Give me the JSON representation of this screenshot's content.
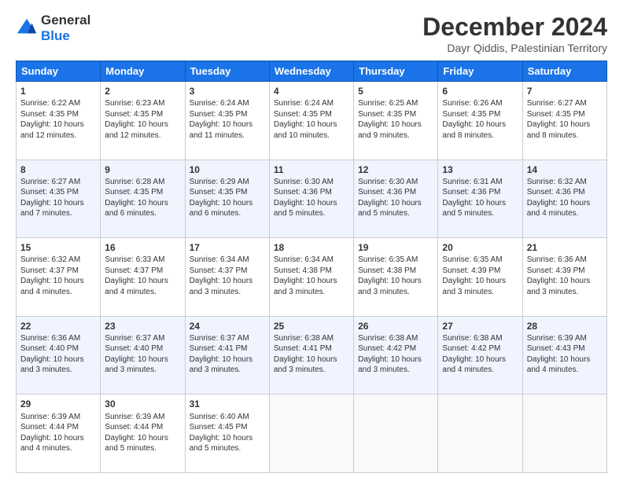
{
  "logo": {
    "line1": "General",
    "line2": "Blue"
  },
  "title": "December 2024",
  "subtitle": "Dayr Qiddis, Palestinian Territory",
  "days_header": [
    "Sunday",
    "Monday",
    "Tuesday",
    "Wednesday",
    "Thursday",
    "Friday",
    "Saturday"
  ],
  "weeks": [
    {
      "row_class": "row-normal",
      "days": [
        {
          "num": "1",
          "sunrise": "Sunrise: 6:22 AM",
          "sunset": "Sunset: 4:35 PM",
          "daylight": "Daylight: 10 hours and 12 minutes."
        },
        {
          "num": "2",
          "sunrise": "Sunrise: 6:23 AM",
          "sunset": "Sunset: 4:35 PM",
          "daylight": "Daylight: 10 hours and 12 minutes."
        },
        {
          "num": "3",
          "sunrise": "Sunrise: 6:24 AM",
          "sunset": "Sunset: 4:35 PM",
          "daylight": "Daylight: 10 hours and 11 minutes."
        },
        {
          "num": "4",
          "sunrise": "Sunrise: 6:24 AM",
          "sunset": "Sunset: 4:35 PM",
          "daylight": "Daylight: 10 hours and 10 minutes."
        },
        {
          "num": "5",
          "sunrise": "Sunrise: 6:25 AM",
          "sunset": "Sunset: 4:35 PM",
          "daylight": "Daylight: 10 hours and 9 minutes."
        },
        {
          "num": "6",
          "sunrise": "Sunrise: 6:26 AM",
          "sunset": "Sunset: 4:35 PM",
          "daylight": "Daylight: 10 hours and 8 minutes."
        },
        {
          "num": "7",
          "sunrise": "Sunrise: 6:27 AM",
          "sunset": "Sunset: 4:35 PM",
          "daylight": "Daylight: 10 hours and 8 minutes."
        }
      ]
    },
    {
      "row_class": "row-alt",
      "days": [
        {
          "num": "8",
          "sunrise": "Sunrise: 6:27 AM",
          "sunset": "Sunset: 4:35 PM",
          "daylight": "Daylight: 10 hours and 7 minutes."
        },
        {
          "num": "9",
          "sunrise": "Sunrise: 6:28 AM",
          "sunset": "Sunset: 4:35 PM",
          "daylight": "Daylight: 10 hours and 6 minutes."
        },
        {
          "num": "10",
          "sunrise": "Sunrise: 6:29 AM",
          "sunset": "Sunset: 4:35 PM",
          "daylight": "Daylight: 10 hours and 6 minutes."
        },
        {
          "num": "11",
          "sunrise": "Sunrise: 6:30 AM",
          "sunset": "Sunset: 4:36 PM",
          "daylight": "Daylight: 10 hours and 5 minutes."
        },
        {
          "num": "12",
          "sunrise": "Sunrise: 6:30 AM",
          "sunset": "Sunset: 4:36 PM",
          "daylight": "Daylight: 10 hours and 5 minutes."
        },
        {
          "num": "13",
          "sunrise": "Sunrise: 6:31 AM",
          "sunset": "Sunset: 4:36 PM",
          "daylight": "Daylight: 10 hours and 5 minutes."
        },
        {
          "num": "14",
          "sunrise": "Sunrise: 6:32 AM",
          "sunset": "Sunset: 4:36 PM",
          "daylight": "Daylight: 10 hours and 4 minutes."
        }
      ]
    },
    {
      "row_class": "row-normal",
      "days": [
        {
          "num": "15",
          "sunrise": "Sunrise: 6:32 AM",
          "sunset": "Sunset: 4:37 PM",
          "daylight": "Daylight: 10 hours and 4 minutes."
        },
        {
          "num": "16",
          "sunrise": "Sunrise: 6:33 AM",
          "sunset": "Sunset: 4:37 PM",
          "daylight": "Daylight: 10 hours and 4 minutes."
        },
        {
          "num": "17",
          "sunrise": "Sunrise: 6:34 AM",
          "sunset": "Sunset: 4:37 PM",
          "daylight": "Daylight: 10 hours and 3 minutes."
        },
        {
          "num": "18",
          "sunrise": "Sunrise: 6:34 AM",
          "sunset": "Sunset: 4:38 PM",
          "daylight": "Daylight: 10 hours and 3 minutes."
        },
        {
          "num": "19",
          "sunrise": "Sunrise: 6:35 AM",
          "sunset": "Sunset: 4:38 PM",
          "daylight": "Daylight: 10 hours and 3 minutes."
        },
        {
          "num": "20",
          "sunrise": "Sunrise: 6:35 AM",
          "sunset": "Sunset: 4:39 PM",
          "daylight": "Daylight: 10 hours and 3 minutes."
        },
        {
          "num": "21",
          "sunrise": "Sunrise: 6:36 AM",
          "sunset": "Sunset: 4:39 PM",
          "daylight": "Daylight: 10 hours and 3 minutes."
        }
      ]
    },
    {
      "row_class": "row-alt",
      "days": [
        {
          "num": "22",
          "sunrise": "Sunrise: 6:36 AM",
          "sunset": "Sunset: 4:40 PM",
          "daylight": "Daylight: 10 hours and 3 minutes."
        },
        {
          "num": "23",
          "sunrise": "Sunrise: 6:37 AM",
          "sunset": "Sunset: 4:40 PM",
          "daylight": "Daylight: 10 hours and 3 minutes."
        },
        {
          "num": "24",
          "sunrise": "Sunrise: 6:37 AM",
          "sunset": "Sunset: 4:41 PM",
          "daylight": "Daylight: 10 hours and 3 minutes."
        },
        {
          "num": "25",
          "sunrise": "Sunrise: 6:38 AM",
          "sunset": "Sunset: 4:41 PM",
          "daylight": "Daylight: 10 hours and 3 minutes."
        },
        {
          "num": "26",
          "sunrise": "Sunrise: 6:38 AM",
          "sunset": "Sunset: 4:42 PM",
          "daylight": "Daylight: 10 hours and 3 minutes."
        },
        {
          "num": "27",
          "sunrise": "Sunrise: 6:38 AM",
          "sunset": "Sunset: 4:42 PM",
          "daylight": "Daylight: 10 hours and 4 minutes."
        },
        {
          "num": "28",
          "sunrise": "Sunrise: 6:39 AM",
          "sunset": "Sunset: 4:43 PM",
          "daylight": "Daylight: 10 hours and 4 minutes."
        }
      ]
    },
    {
      "row_class": "row-normal",
      "days": [
        {
          "num": "29",
          "sunrise": "Sunrise: 6:39 AM",
          "sunset": "Sunset: 4:44 PM",
          "daylight": "Daylight: 10 hours and 4 minutes."
        },
        {
          "num": "30",
          "sunrise": "Sunrise: 6:39 AM",
          "sunset": "Sunset: 4:44 PM",
          "daylight": "Daylight: 10 hours and 5 minutes."
        },
        {
          "num": "31",
          "sunrise": "Sunrise: 6:40 AM",
          "sunset": "Sunset: 4:45 PM",
          "daylight": "Daylight: 10 hours and 5 minutes."
        },
        {
          "num": "",
          "sunrise": "",
          "sunset": "",
          "daylight": ""
        },
        {
          "num": "",
          "sunrise": "",
          "sunset": "",
          "daylight": ""
        },
        {
          "num": "",
          "sunrise": "",
          "sunset": "",
          "daylight": ""
        },
        {
          "num": "",
          "sunrise": "",
          "sunset": "",
          "daylight": ""
        }
      ]
    }
  ]
}
